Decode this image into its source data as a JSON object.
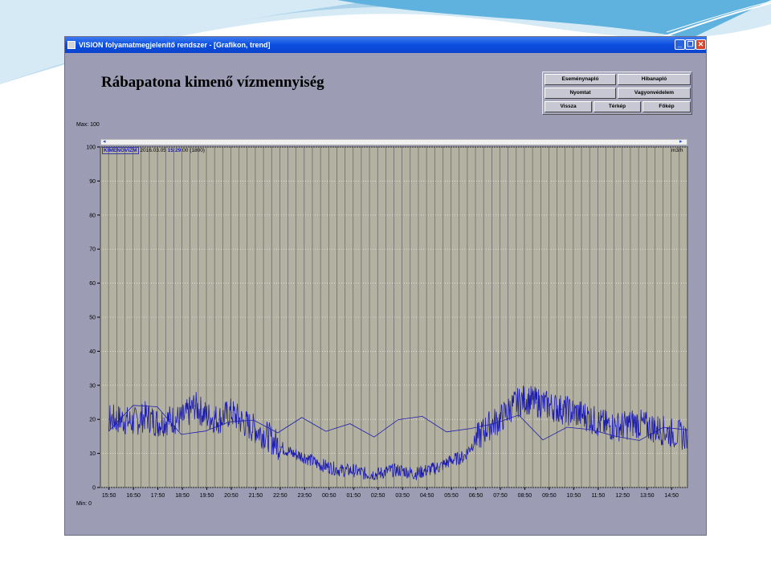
{
  "window": {
    "title": "VISION folyamatmegjelenítő rendszer - [Grafikon, trend]",
    "minimize_glyph": "_",
    "restore_glyph": "❐",
    "close_glyph": "✕"
  },
  "page": {
    "title": "Rábapatona kimenő vízmennyiség"
  },
  "buttons": {
    "esemenynaplo": "Eseménynapló",
    "hibanaplo": "Hibanapló",
    "nyomtat": "Nyomtat",
    "vagyonvedelem": "Vagyonvédelem",
    "vissza": "Vissza",
    "terkep": "Térkép",
    "fokep": "Főkép"
  },
  "axis_labels": {
    "max": "Max: 100",
    "min": "Min: 0"
  },
  "plot_header": {
    "tag": "KIMENOVIZM",
    "date": "2016.03.05",
    "time": "15:29",
    "seconds": ":00",
    "span": "(1800)",
    "unit": "m3/h",
    "scroll_left": "◂",
    "scroll_right": "▸"
  },
  "chart_data": {
    "type": "line",
    "ylim": [
      0,
      100
    ],
    "yticks": [
      0,
      10,
      20,
      30,
      40,
      50,
      60,
      70,
      80,
      90,
      100
    ],
    "xticks": [
      "15:50",
      "16:50",
      "17:50",
      "18:50",
      "19:50",
      "20:50",
      "21:50",
      "22:50",
      "23:50",
      "00:50",
      "01:50",
      "02:50",
      "03:50",
      "04:50",
      "05:50",
      "06:50",
      "07:50",
      "08:50",
      "09:50",
      "10:50",
      "11:50",
      "12:50",
      "13:50",
      "14:50"
    ],
    "grid": true,
    "series": [
      {
        "color": "#1c1cae",
        "x": [
          "15:29",
          "15:50",
          "16:20",
          "16:50",
          "17:20",
          "17:50",
          "18:20",
          "18:50",
          "19:20",
          "19:50",
          "20:20",
          "20:50",
          "21:20",
          "21:50",
          "22:20",
          "22:50",
          "23:20",
          "23:50",
          "00:20",
          "00:50",
          "01:20",
          "01:50",
          "02:20",
          "02:50",
          "03:20",
          "03:50",
          "04:20",
          "04:50",
          "05:20",
          "05:50",
          "06:20",
          "06:50",
          "07:20",
          "07:50",
          "08:20",
          "08:50",
          "09:20",
          "09:50",
          "10:20",
          "10:50",
          "11:20",
          "11:50",
          "12:20",
          "12:50",
          "13:20",
          "13:50",
          "14:20",
          "14:50",
          "15:29"
        ],
        "values": [
          17,
          20,
          20,
          19,
          21,
          19,
          20,
          20,
          24,
          21,
          20,
          22,
          19,
          17,
          15,
          12,
          10,
          9,
          7,
          6,
          5,
          5,
          4,
          4,
          5,
          5,
          4,
          5,
          6,
          8,
          9,
          14,
          18,
          20,
          24,
          26,
          25,
          24,
          23,
          22,
          21,
          19,
          18,
          18,
          19,
          18,
          17,
          16,
          15
        ]
      }
    ]
  }
}
